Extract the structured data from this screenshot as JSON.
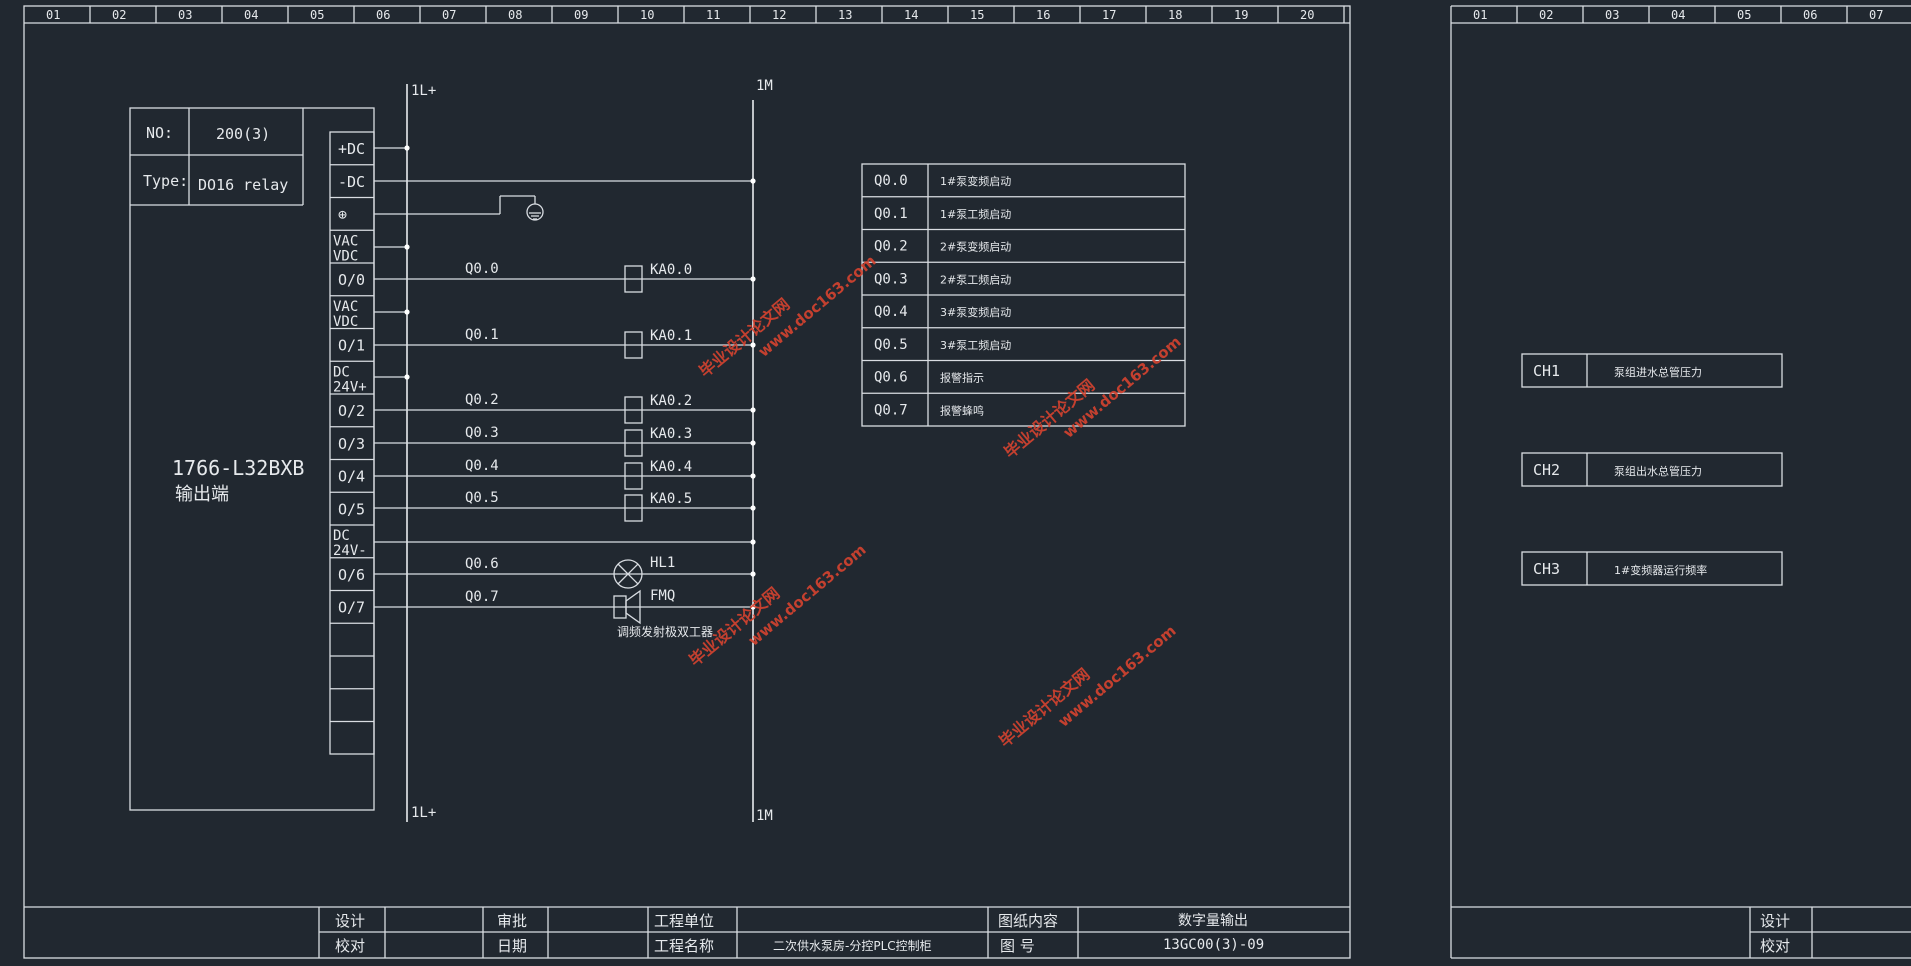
{
  "ruler_left": [
    "01",
    "02",
    "03",
    "04",
    "05",
    "06",
    "07",
    "08",
    "09",
    "10",
    "11",
    "12",
    "13",
    "14",
    "15",
    "16",
    "17",
    "18",
    "19",
    "20"
  ],
  "ruler_right": [
    "01",
    "02",
    "03",
    "04",
    "05",
    "06",
    "07"
  ],
  "module": {
    "no_label": "NO:",
    "no_value": "200(3)",
    "type_label": "Type:",
    "type_value": "DO16 relay",
    "model": "1766-L32BXB",
    "model_sub": "输出端"
  },
  "bus": {
    "left_top": "1L+",
    "left_bottom": "1L+",
    "right_top": "1M",
    "right_bottom": "1M"
  },
  "terminals": [
    "+DC",
    "-DC",
    "⊕",
    "VAC\nVDC",
    "O/0",
    "VAC\nVDC",
    "O/1",
    "DC\n24V+",
    "O/2",
    "O/3",
    "O/4",
    "O/5",
    "DC\n24V-",
    "O/6",
    "O/7",
    "",
    "",
    "",
    ""
  ],
  "rungs": [
    {
      "addr": "Q0.0",
      "device": "KA0.0"
    },
    {
      "addr": "Q0.1",
      "device": "KA0.1"
    },
    {
      "addr": "Q0.2",
      "device": "KA0.2"
    },
    {
      "addr": "Q0.3",
      "device": "KA0.3"
    },
    {
      "addr": "Q0.4",
      "device": "KA0.4"
    },
    {
      "addr": "Q0.5",
      "device": "KA0.5"
    },
    {
      "addr": "Q0.6",
      "device": "HL1"
    },
    {
      "addr": "Q0.7",
      "device": "FMQ"
    }
  ],
  "buzzer_note": "调频发射极双工器",
  "io_table": [
    {
      "addr": "Q0.0",
      "desc": "1#泵变频启动"
    },
    {
      "addr": "Q0.1",
      "desc": "1#泵工频启动"
    },
    {
      "addr": "Q0.2",
      "desc": "2#泵变频启动"
    },
    {
      "addr": "Q0.3",
      "desc": "2#泵工频启动"
    },
    {
      "addr": "Q0.4",
      "desc": "3#泵变频启动"
    },
    {
      "addr": "Q0.5",
      "desc": "3#泵工频启动"
    },
    {
      "addr": "Q0.6",
      "desc": "报警指示"
    },
    {
      "addr": "Q0.7",
      "desc": "报警蜂鸣"
    }
  ],
  "channels": [
    {
      "ch": "CH1",
      "desc": "泵组进水总管压力"
    },
    {
      "ch": "CH2",
      "desc": "泵组出水总管压力"
    },
    {
      "ch": "CH3",
      "desc": "1#变频器运行频率"
    }
  ],
  "watermark": {
    "cn": "毕业设计论文网",
    "url": "www.doc163.com"
  },
  "title_block": {
    "design": "设计",
    "check": "校对",
    "approve": "审批",
    "date": "日期",
    "unit": "工程单位",
    "project_name_label": "工程名称",
    "project_name": "二次供水泵房-分控PLC控制柜",
    "content_label": "图纸内容",
    "content": "数字量输出",
    "drawing_no_label": "图  号",
    "drawing_no": "13GC00(3)-09"
  },
  "title_block_right": {
    "design": "设计",
    "check": "校对"
  },
  "colors": {
    "background": "#212830",
    "line": "#d9dde2",
    "watermark": "#d6432f"
  }
}
